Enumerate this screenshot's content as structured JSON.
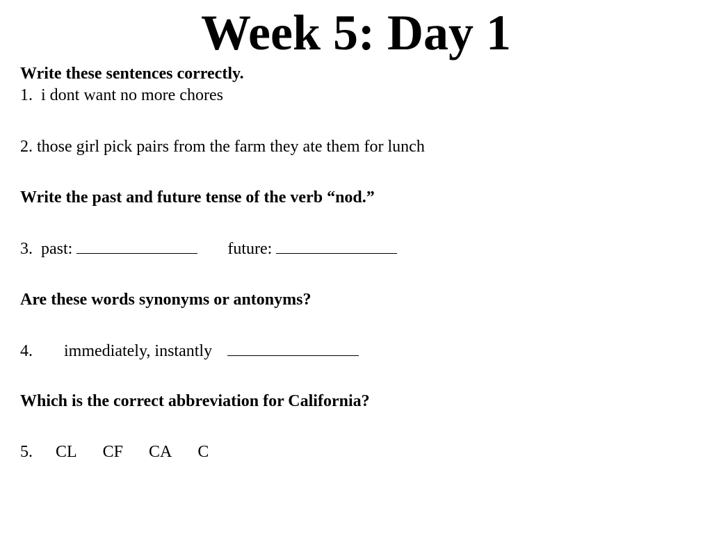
{
  "title": "Week 5: Day 1",
  "sections": {
    "s1": {
      "instruction": "Write these sentences correctly.",
      "q1": {
        "number": "1.",
        "text": "i dont want no more chores"
      },
      "q2": {
        "number": "2.",
        "text": "those girl pick pairs from the farm they ate them for lunch"
      }
    },
    "s2": {
      "instruction": "Write the past and future tense of the verb “nod.”",
      "q3": {
        "number": "3.",
        "past_label": "past:",
        "future_label": "future:",
        "past_value": "",
        "future_value": ""
      }
    },
    "s3": {
      "instruction": "Are these words synonyms or antonyms?",
      "q4": {
        "number": "4.",
        "text": "immediately, instantly",
        "answer_value": ""
      }
    },
    "s4": {
      "instruction": "Which is the correct abbreviation for California?",
      "q5": {
        "number": "5.",
        "options": [
          "CL",
          "CF",
          "CA",
          "C"
        ]
      }
    }
  }
}
